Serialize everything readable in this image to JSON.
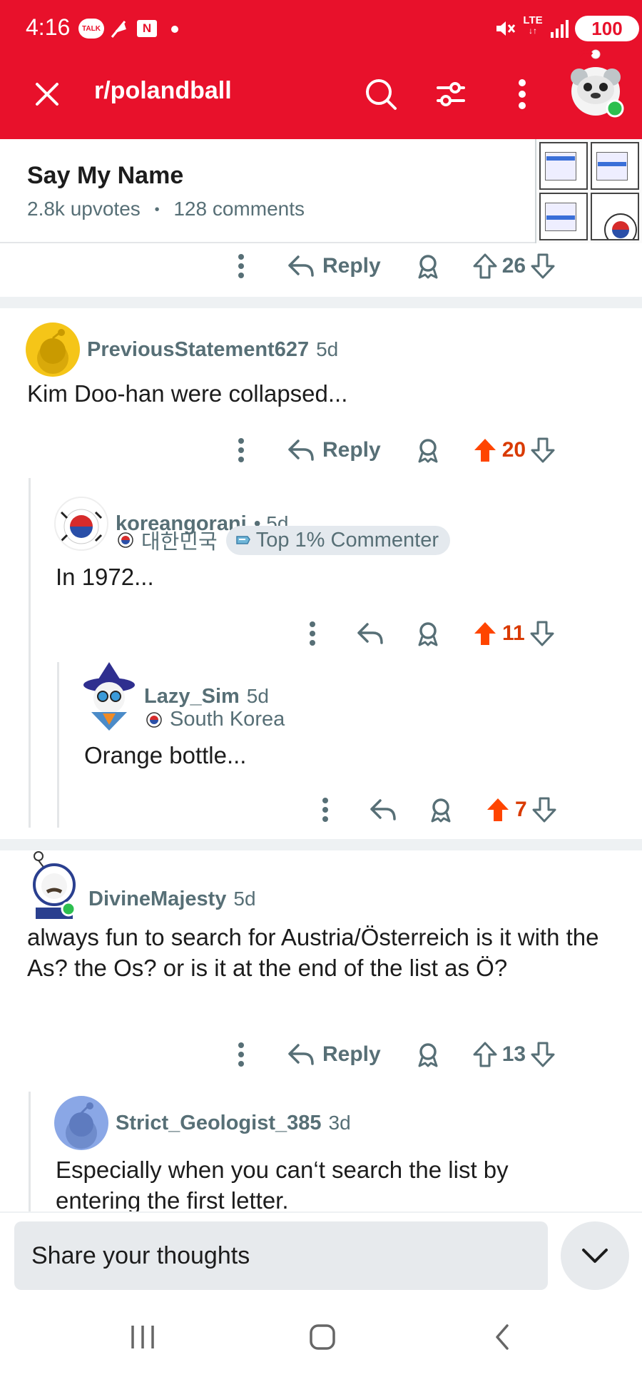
{
  "status_bar": {
    "time": "4:16",
    "talk_label": "TALK",
    "n_label": "N",
    "network_label": "LTE",
    "battery": "100"
  },
  "toolbar": {
    "subreddit": "r/polandball"
  },
  "post": {
    "title": "Say My Name",
    "upvotes": "2.8k upvotes",
    "separator": "•",
    "comments": "128 comments"
  },
  "top_actions": {
    "reply": "Reply",
    "votes": "26"
  },
  "comments": [
    {
      "user": "PreviousStatement627",
      "age": "5d",
      "text": "Kim Doo-han were collapsed...",
      "reply": "Reply",
      "votes": "20",
      "upvoted": true
    },
    {
      "user": "koreangorani",
      "age": "• 5d",
      "flair": "대한민국",
      "badge": "Top 1% Commenter",
      "text": "In 1972...",
      "votes": "11",
      "upvoted": true
    },
    {
      "user": "Lazy_Sim",
      "age": "5d",
      "flair": "South Korea",
      "text": "Orange bottle...",
      "votes": "7",
      "upvoted": true
    },
    {
      "user": "DivineMajesty",
      "age": "5d",
      "text": "always fun to search for Austria/Österreich is it with the As? the Os? or is it at the end of the list as Ö?",
      "reply": "Reply",
      "votes": "13",
      "upvoted": false
    },
    {
      "user": "Strict_Geologist_385",
      "age": "3d",
      "text": "Especially when you can‘t search the list by entering the first letter."
    }
  ],
  "composer": {
    "placeholder": "Share your thoughts"
  },
  "colors": {
    "header_red": "#e8112b",
    "upvote_orange": "#ff4500",
    "vote_count_orange": "#d93a00",
    "meta_grey": "#576f76"
  },
  "icons": [
    "close-icon",
    "search-icon",
    "filter-icon",
    "more-vertical-icon",
    "reply-icon",
    "award-icon",
    "upvote-icon",
    "downvote-icon",
    "chevron-down-icon",
    "recents-icon",
    "home-icon",
    "back-icon"
  ]
}
